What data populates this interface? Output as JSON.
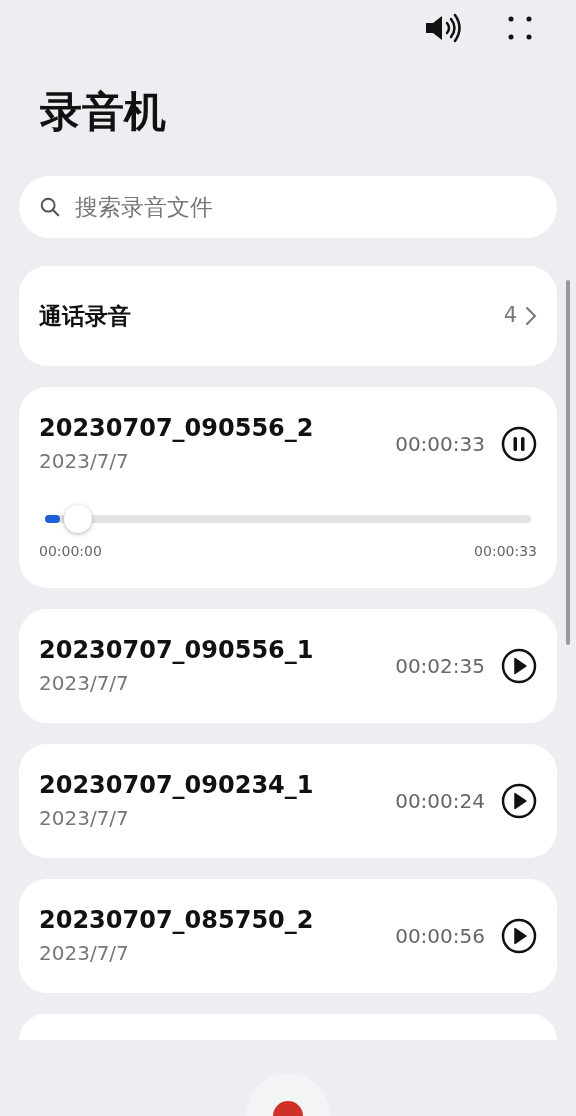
{
  "title": "录音机",
  "search": {
    "placeholder": "搜索录音文件"
  },
  "call_recordings": {
    "label": "通话录音",
    "count": "4"
  },
  "recordings": [
    {
      "name": "20230707_090556_2",
      "date": "2023/7/7",
      "duration": "00:00:33",
      "playing": true,
      "progress": {
        "level": 0.03,
        "elapsed": "00:00:00",
        "total": "00:00:33"
      }
    },
    {
      "name": "20230707_090556_1",
      "date": "2023/7/7",
      "duration": "00:02:35",
      "playing": false
    },
    {
      "name": "20230707_090234_1",
      "date": "2023/7/7",
      "duration": "00:00:24",
      "playing": false
    },
    {
      "name": "20230707_085750_2",
      "date": "2023/7/7",
      "duration": "00:00:56",
      "playing": false
    }
  ]
}
